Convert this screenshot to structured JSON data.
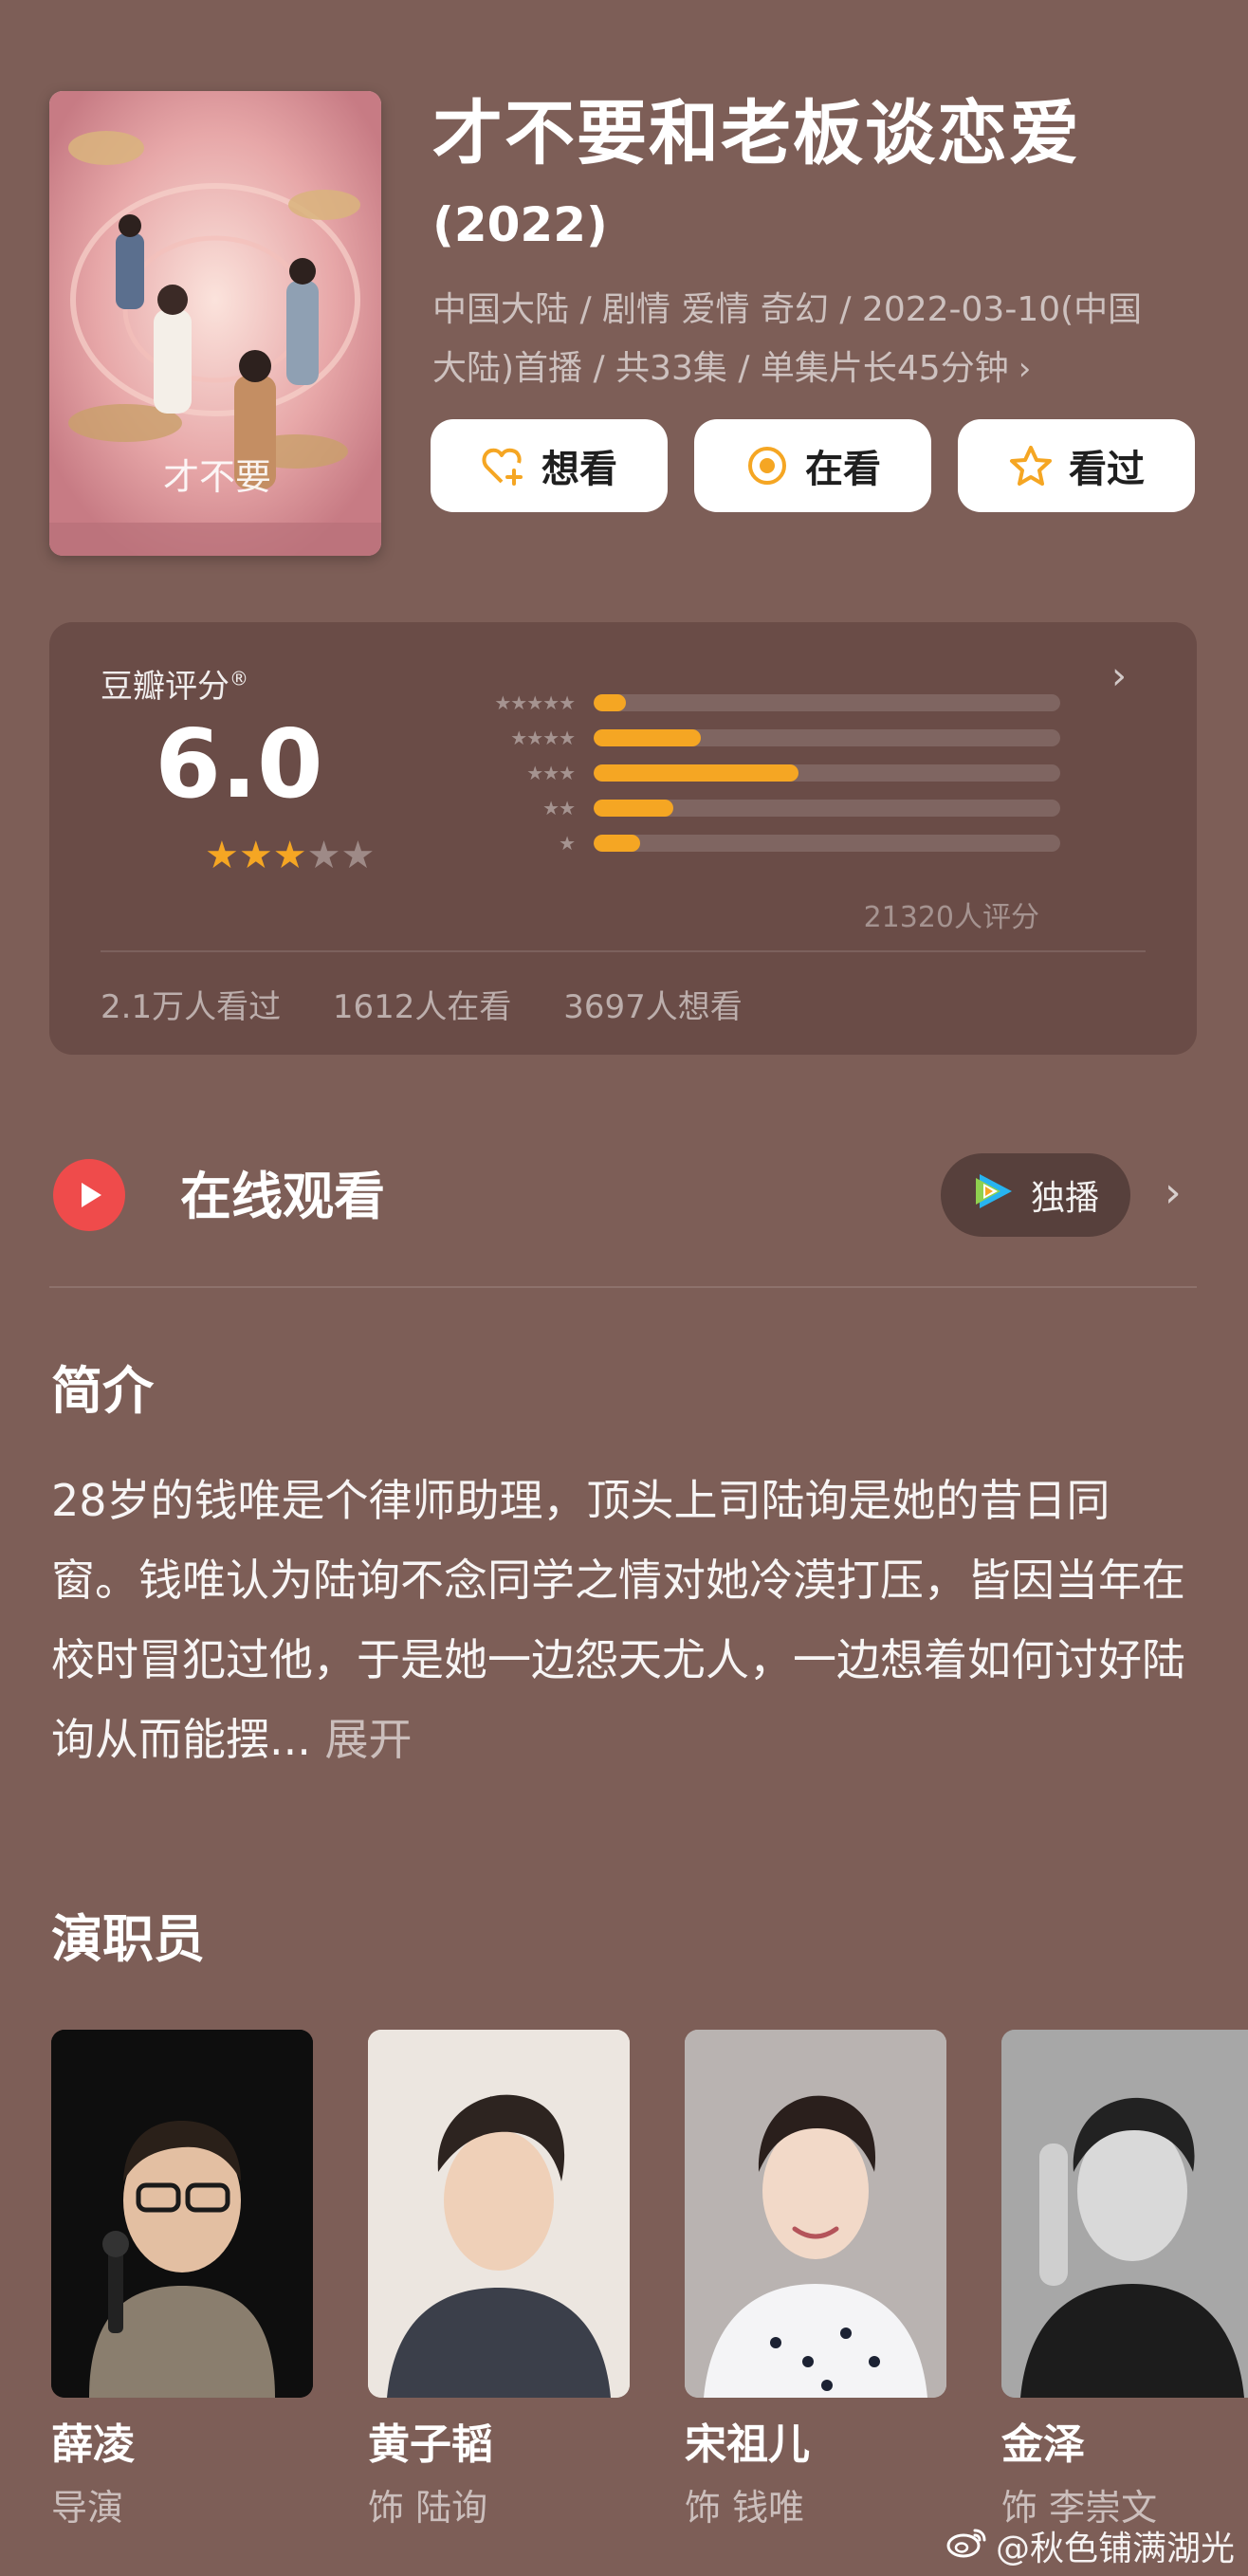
{
  "header": {
    "title": "才不要和老板谈恋爱",
    "year": "(2022)",
    "meta_line1": "中国大陆 / 剧情 爱情 奇幻 / 2022-03-10(中国",
    "meta_line2": "大陆)首播 / 共33集 / 单集片长45分钟",
    "buttons": [
      {
        "label": "想看",
        "icon": "heart-plus-icon"
      },
      {
        "label": "在看",
        "icon": "target-icon"
      },
      {
        "label": "看过",
        "icon": "star-outline-icon"
      }
    ]
  },
  "rating": {
    "label": "豆瓣评分",
    "label_mark": "®",
    "score": "6.0",
    "stars": 3,
    "distribution": [
      {
        "stars": "★★★★★",
        "fraction": 0.07
      },
      {
        "stars": "★★★★",
        "fraction": 0.23
      },
      {
        "stars": "★★★",
        "fraction": 0.44
      },
      {
        "stars": "★★",
        "fraction": 0.17
      },
      {
        "stars": "★",
        "fraction": 0.1
      }
    ],
    "count": "21320人评分",
    "stats": [
      "2.1万人看过",
      "1612人在看",
      "3697人想看"
    ]
  },
  "watch": {
    "title": "在线观看",
    "platform_label": "独播"
  },
  "synopsis": {
    "title": "简介",
    "text": "28岁的钱唯是个律师助理，顶头上司陆询是她的昔日同窗。钱唯认为陆询不念同学之情对她冷漠打压，皆因当年在校时冒犯过他，于是她一边怨天尤人，一边想着如何讨好陆询从而能摆...",
    "expand": "展开"
  },
  "cast": {
    "title": "演职员",
    "members": [
      {
        "name": "薛凌",
        "role": "导演"
      },
      {
        "name": "黄子韬",
        "role": "饰 陆询"
      },
      {
        "name": "宋祖儿",
        "role": "饰 钱唯"
      },
      {
        "name": "金泽",
        "role": "饰 李崇文"
      }
    ]
  },
  "watermark": "@秋色铺满湖光",
  "colors": {
    "background": "#7d5e57",
    "card": "#6a4c47",
    "accent_star": "#f5a623",
    "play_red": "#ef4b4b"
  }
}
